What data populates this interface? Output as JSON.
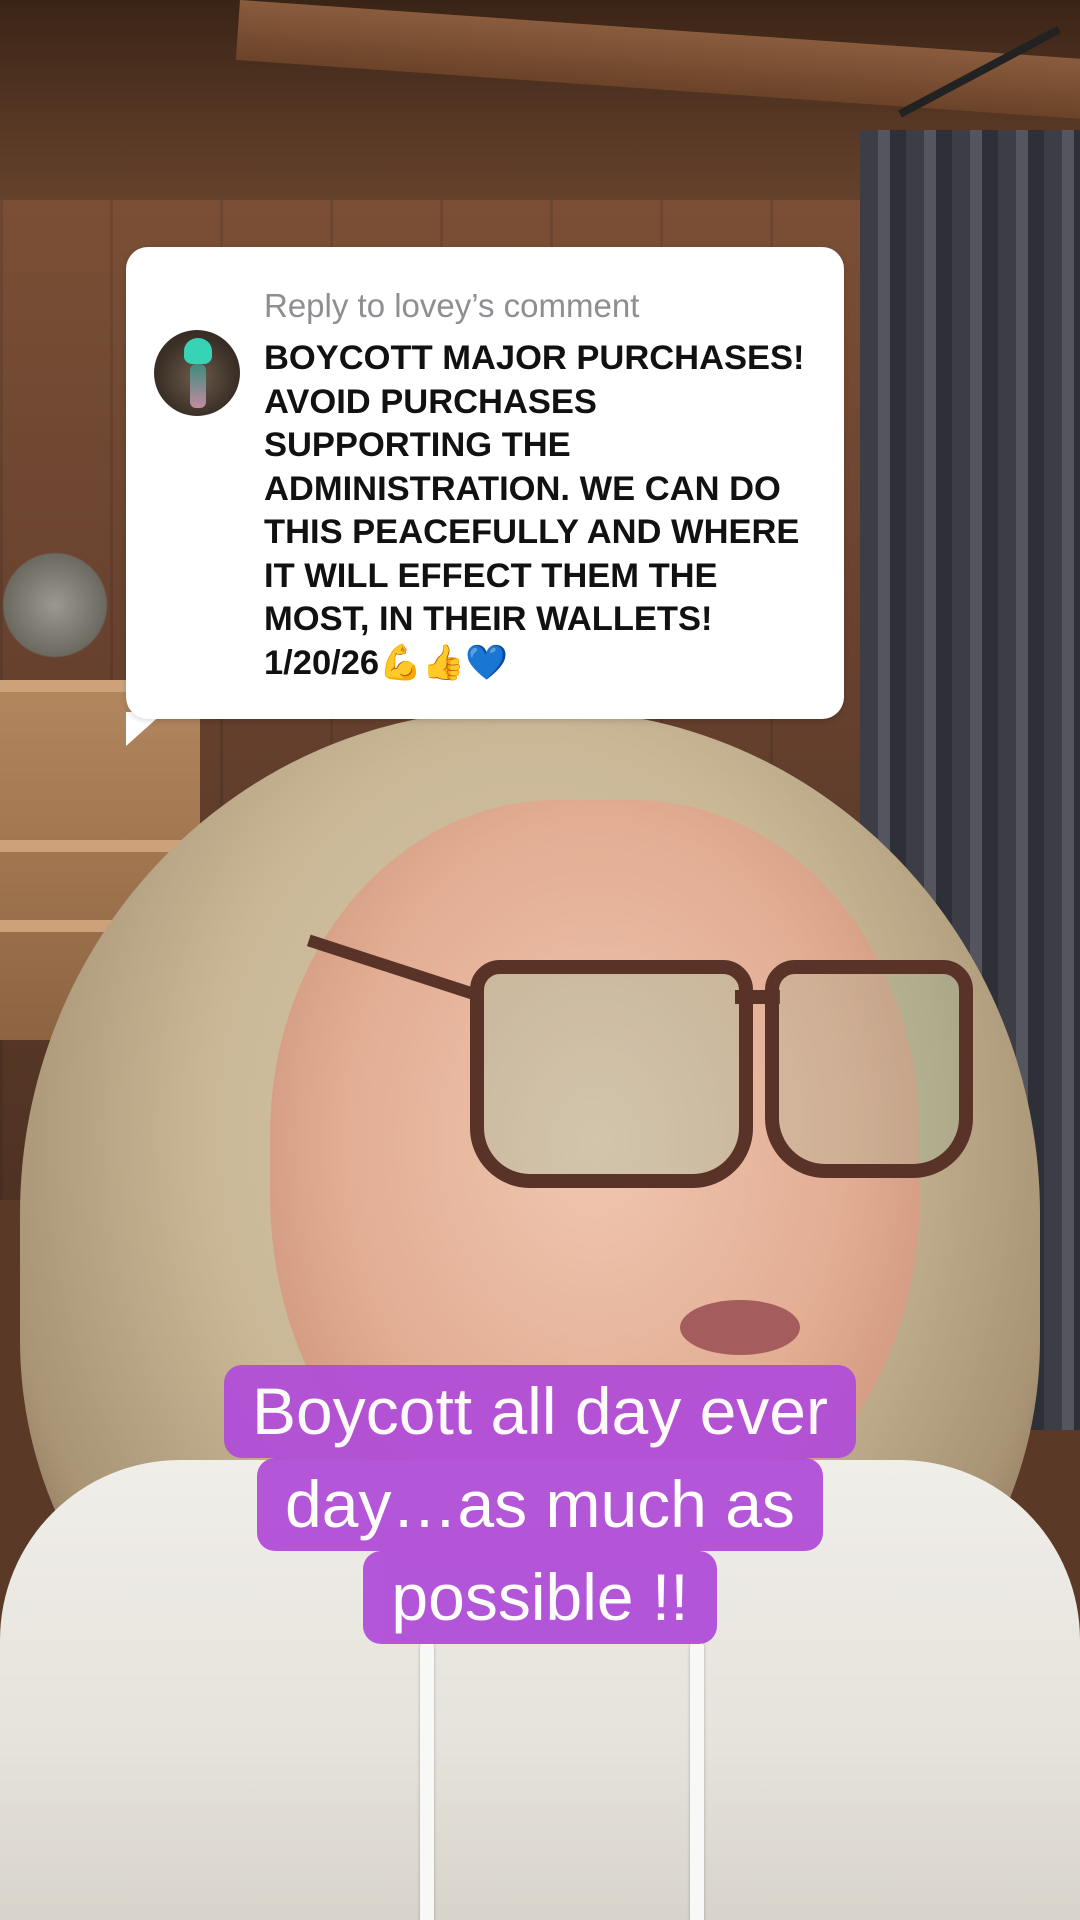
{
  "reply_sticker": {
    "header": "Reply to lovey’s comment",
    "comment_text": "BOYCOTT MAJOR PURCHASES! AVOID PURCHASES SUPPORTING THE ADMINISTRATION. WE CAN DO THIS PEACEFULLY AND WHERE IT WILL EFFECT THEM THE MOST, IN THEIR WALLETS! 1/20/26💪👍💙",
    "avatar_icon": "commenter-avatar"
  },
  "caption": {
    "lines": [
      "Boycott all day ever",
      "day…as much as",
      "possible !!"
    ]
  },
  "colors": {
    "caption_background": "#b14ed8",
    "sticker_background": "#ffffff",
    "header_text": "#8e8e93"
  }
}
